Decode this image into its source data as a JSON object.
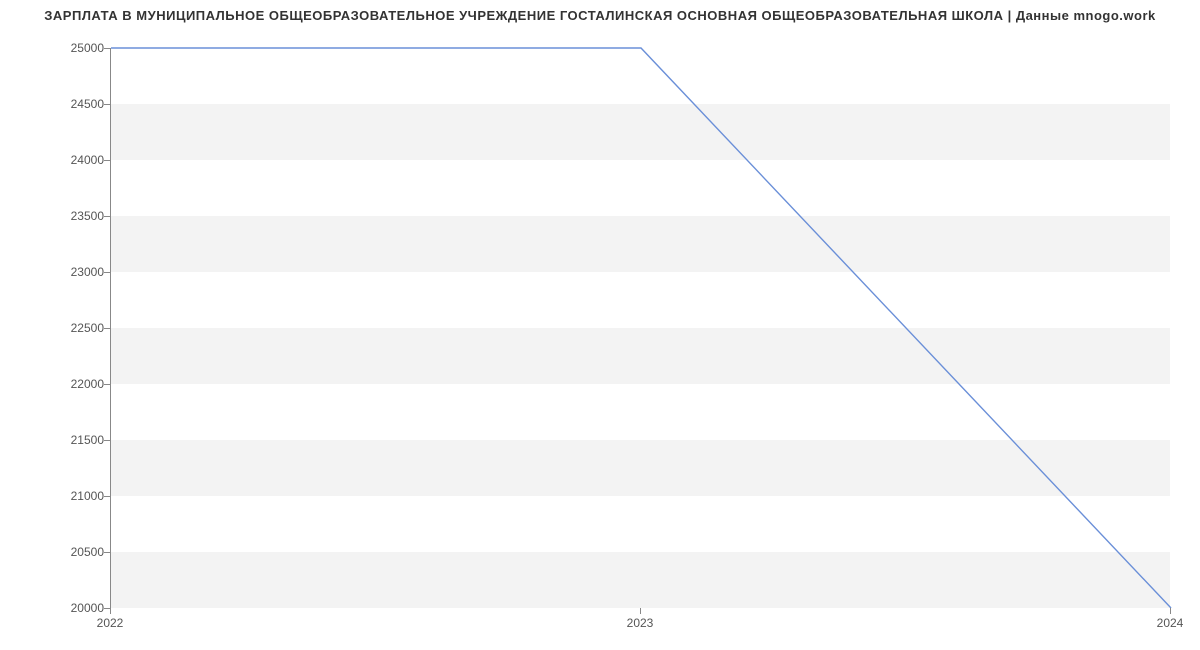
{
  "chart_data": {
    "type": "line",
    "title": "ЗАРПЛАТА В МУНИЦИПАЛЬНОЕ ОБЩЕОБРАЗОВАТЕЛЬНОЕ УЧРЕЖДЕНИЕ ГОСТАЛИНСКАЯ ОСНОВНАЯ ОБЩЕОБРАЗОВАТЕЛЬНАЯ ШКОЛА | Данные mnogo.work",
    "x": [
      2022,
      2023,
      2024
    ],
    "values": [
      25000,
      25000,
      20000
    ],
    "xlabel": "",
    "ylabel": "",
    "x_ticks": [
      2022,
      2023,
      2024
    ],
    "y_ticks": [
      20000,
      20500,
      21000,
      21500,
      22000,
      22500,
      23000,
      23500,
      24000,
      24500,
      25000
    ],
    "xlim": [
      2022,
      2024
    ],
    "ylim": [
      20000,
      25000
    ],
    "line_color": "#6a8fd8",
    "band_color": "#f3f3f3"
  }
}
